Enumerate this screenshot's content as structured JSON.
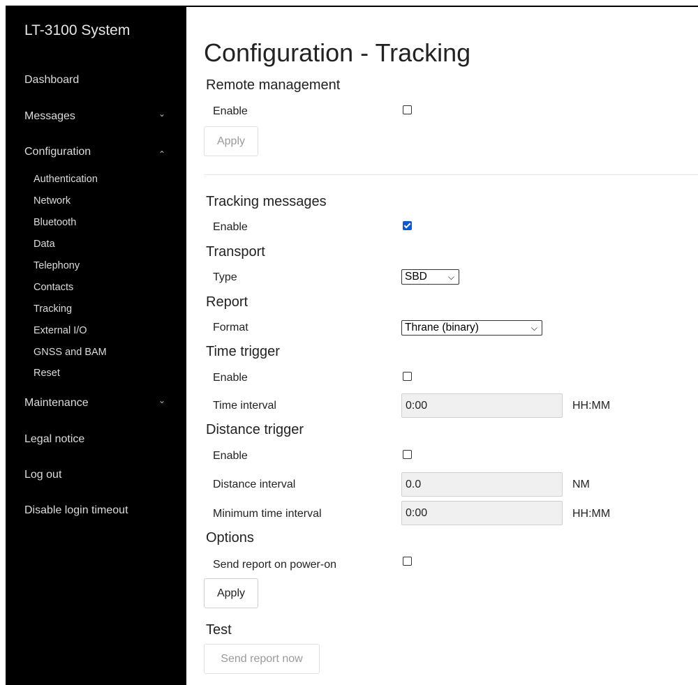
{
  "sidebar": {
    "brand": "LT-3100 System",
    "items": {
      "dashboard": "Dashboard",
      "messages": "Messages",
      "configuration": "Configuration",
      "maintenance": "Maintenance",
      "legal": "Legal notice",
      "logout": "Log out",
      "disable_timeout": "Disable login timeout"
    },
    "chevrons": {
      "collapsed": "⌄",
      "expanded": "⌃"
    },
    "sub_items": [
      "Authentication",
      "Network",
      "Bluetooth",
      "Data",
      "Telephony",
      "Contacts",
      "Tracking",
      "External I/O",
      "GNSS and BAM",
      "Reset"
    ]
  },
  "main": {
    "title": "Configuration - Tracking",
    "remote": {
      "heading": "Remote management",
      "enable_label": "Enable",
      "enable_checked": false,
      "apply_label": "Apply"
    },
    "tracking": {
      "heading": "Tracking messages",
      "enable_label": "Enable",
      "enable_checked": true
    },
    "transport": {
      "heading": "Transport",
      "type_label": "Type",
      "type_value": "SBD"
    },
    "report": {
      "heading": "Report",
      "format_label": "Format",
      "format_value": "Thrane (binary)"
    },
    "time_trigger": {
      "heading": "Time trigger",
      "enable_label": "Enable",
      "enable_checked": false,
      "interval_label": "Time interval",
      "interval_value": "0:00",
      "interval_unit": "HH:MM"
    },
    "distance_trigger": {
      "heading": "Distance trigger",
      "enable_label": "Enable",
      "enable_checked": false,
      "distance_label": "Distance interval",
      "distance_value": "0.0",
      "distance_unit": "NM",
      "min_time_label": "Minimum time interval",
      "min_time_value": "0:00",
      "min_time_unit": "HH:MM"
    },
    "options": {
      "heading": "Options",
      "power_on_label": "Send report on power-on",
      "power_on_checked": false,
      "apply_label": "Apply"
    },
    "test": {
      "heading": "Test",
      "send_label": "Send report now"
    }
  },
  "colors": {
    "sidebar_bg": "#000000",
    "checkbox_accent": "#0a5ad4",
    "input_bg": "#f0f0f0"
  }
}
